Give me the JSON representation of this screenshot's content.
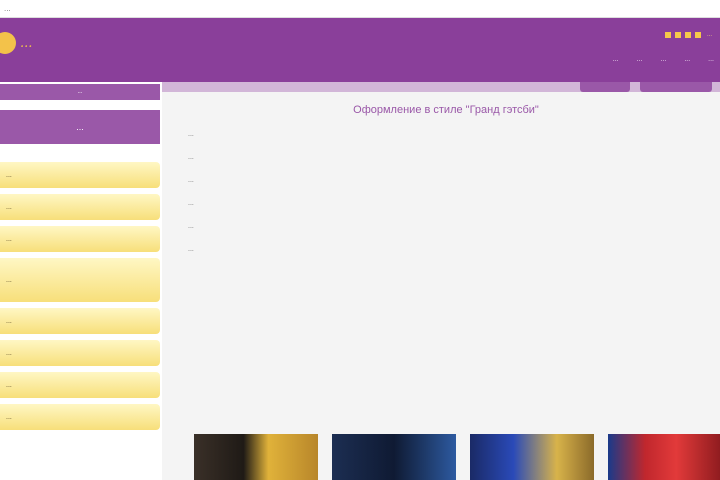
{
  "browser": {
    "url": "..."
  },
  "header": {
    "logo_text": "...",
    "phones": "...",
    "nav": [
      "...",
      "...",
      "...",
      "...",
      "..."
    ]
  },
  "sidebar": {
    "top_label": "...",
    "title": "...",
    "items": [
      "...",
      "...",
      "...",
      "...",
      "...",
      "...",
      "...",
      "..."
    ]
  },
  "main": {
    "title": "Оформление в стиле \"Гранд гэтсби\"",
    "paragraphs": [
      "...",
      "...",
      "...",
      "...",
      "...",
      "..."
    ]
  },
  "colors": {
    "brand_purple": "#8a3f9a",
    "accent_yellow": "#f3c24a",
    "sidebar_item_yellow": "#f7df7a"
  },
  "icons": [
    "sun-logo-icon",
    "social-icon",
    "social-icon",
    "social-icon",
    "social-icon"
  ]
}
